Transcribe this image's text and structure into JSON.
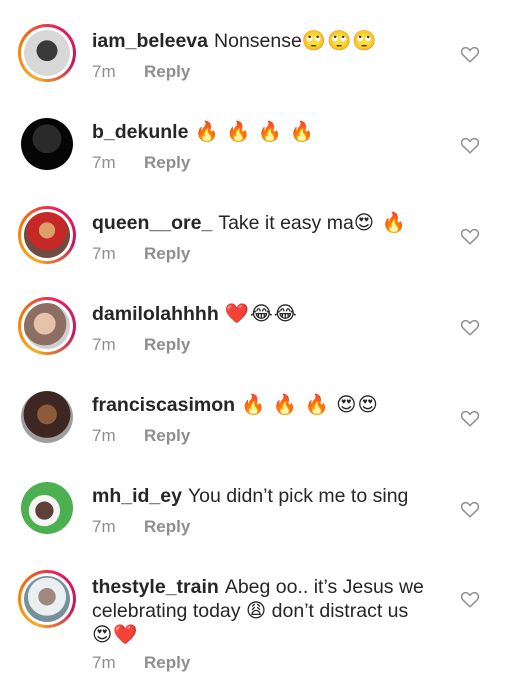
{
  "comments": [
    {
      "username": "iam_beleeva",
      "text": "Nonsense",
      "emoji": "🙄🙄🙄",
      "time": "7m",
      "reply": "Reply"
    },
    {
      "username": "b_dekunle",
      "text": "",
      "emoji": "🔥 🔥 🔥 🔥",
      "time": "7m",
      "reply": "Reply"
    },
    {
      "username": "queen__ore_",
      "text": "Take it easy ma",
      "emoji": "😍 🔥",
      "time": "7m",
      "reply": "Reply"
    },
    {
      "username": "damilolahhhh",
      "text": "",
      "emoji": "❤️😂😂",
      "time": "7m",
      "reply": "Reply"
    },
    {
      "username": "franciscasimon",
      "text": "",
      "emoji": "🔥 🔥 🔥 😍😍",
      "time": "7m",
      "reply": "Reply"
    },
    {
      "username": "mh_id_ey",
      "text": "You didn’t pick me to sing",
      "emoji": "",
      "time": "7m",
      "reply": "Reply"
    },
    {
      "username": "thestyle_train",
      "text": "Abeg oo.. it’s Jesus we celebrating today 😩  don’t distract us",
      "emoji": "😍❤️",
      "time": "7m",
      "reply": "Reply"
    }
  ],
  "colors": {
    "meta": "#8e8e8e",
    "text": "#262626",
    "heart": "#8e8e8e"
  },
  "icons": {
    "like": "heart-outline-icon"
  }
}
